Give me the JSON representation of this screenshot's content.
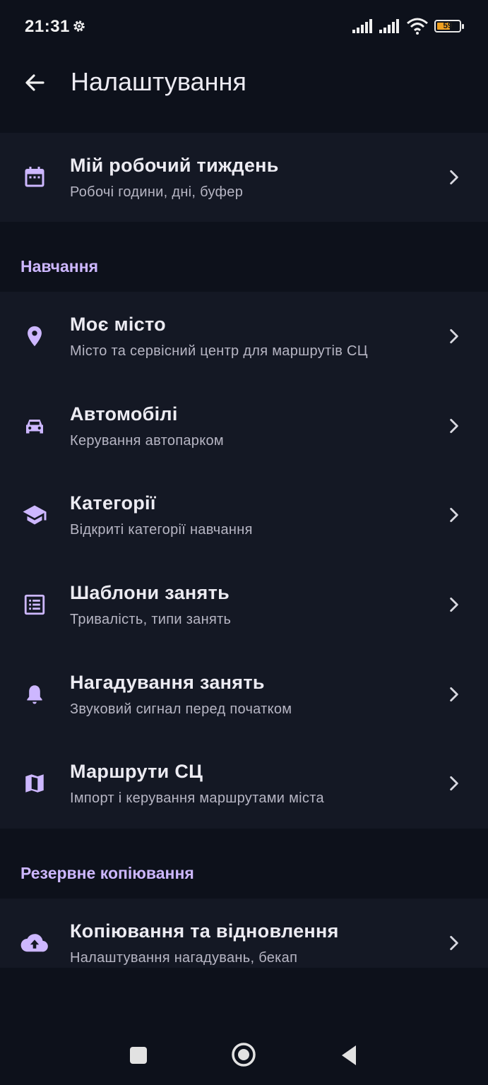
{
  "status_bar": {
    "time": "21:31",
    "battery_percent": "59",
    "battery_color": "#f0a020"
  },
  "app_bar": {
    "title": "Налаштування",
    "back_icon": "arrow-left-icon"
  },
  "accent_color": "#cdb7ff",
  "top_item": {
    "title": "Мій робочий тиждень",
    "subtitle": "Робочі години, дні, буфер",
    "icon": "calendar-icon"
  },
  "sections": [
    {
      "header": "Навчання",
      "items": [
        {
          "title": "Моє місто",
          "subtitle": "Місто та сервісний центр для маршрутів СЦ",
          "icon": "location-pin-icon"
        },
        {
          "title": "Автомобілі",
          "subtitle": "Керування автопарком",
          "icon": "car-icon"
        },
        {
          "title": "Категорії",
          "subtitle": "Відкриті категорії навчання",
          "icon": "graduation-cap-icon"
        },
        {
          "title": "Шаблони занять",
          "subtitle": "Тривалість, типи занять",
          "icon": "list-icon"
        },
        {
          "title": "Нагадування занять",
          "subtitle": "Звуковий сигнал перед початком",
          "icon": "bell-icon"
        },
        {
          "title": "Маршрути СЦ",
          "subtitle": "Імпорт і керування маршрутами міста",
          "icon": "map-icon"
        }
      ]
    },
    {
      "header": "Резервне копіювання",
      "items": [
        {
          "title": "Копіювання та відновлення",
          "subtitle": "Налаштування нагадувань, бекап",
          "icon": "cloud-upload-icon"
        }
      ]
    }
  ],
  "nav_bar": {
    "buttons": [
      "recents-square-icon",
      "home-circle-icon",
      "back-triangle-icon"
    ]
  }
}
